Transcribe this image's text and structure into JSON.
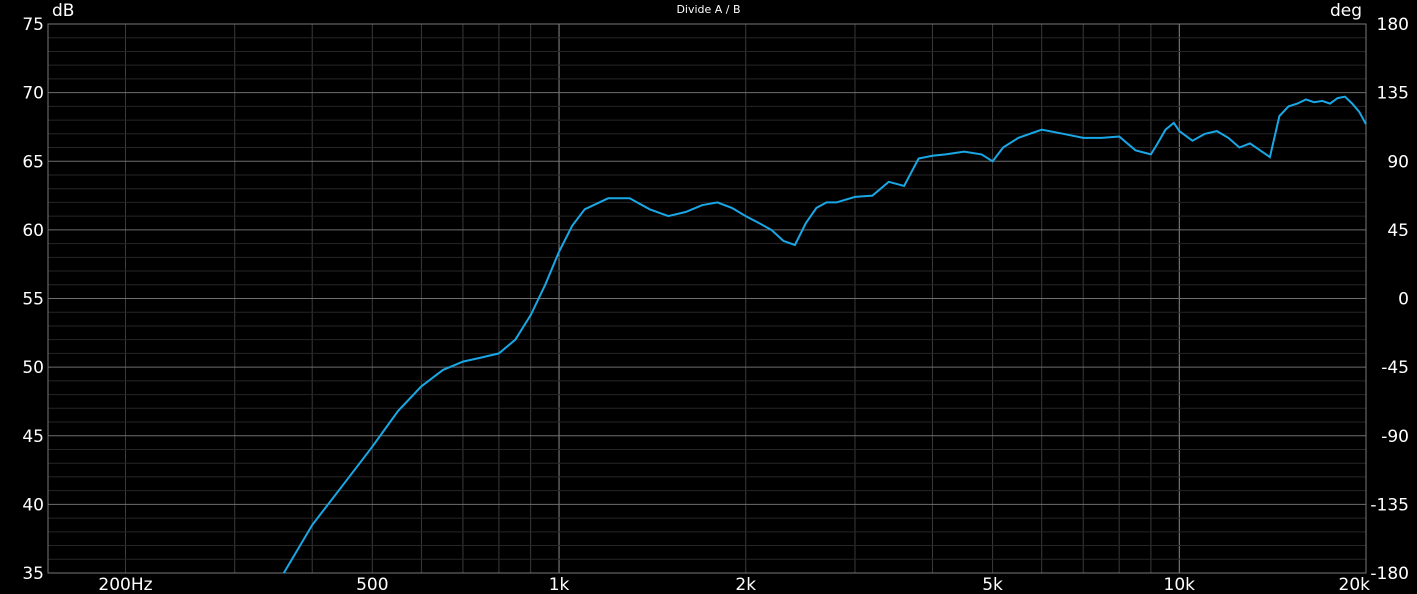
{
  "chart_data": {
    "type": "line",
    "title": "Divide A / B",
    "ylabel_left": "dB",
    "ylabel_right": "deg",
    "xscale": "log",
    "xlim": [
      150,
      20000
    ],
    "ylim": [
      35,
      75
    ],
    "ylim_right": [
      -180,
      180
    ],
    "grid": true,
    "x_ticks": [
      {
        "value": 200,
        "label": "200Hz"
      },
      {
        "value": 500,
        "label": "500"
      },
      {
        "value": 1000,
        "label": "1k"
      },
      {
        "value": 2000,
        "label": "2k"
      },
      {
        "value": 5000,
        "label": "5k"
      },
      {
        "value": 10000,
        "label": "10k"
      },
      {
        "value": 20000,
        "label": "20k"
      }
    ],
    "y_ticks_left": [
      "35",
      "40",
      "45",
      "50",
      "55",
      "60",
      "65",
      "70",
      "75"
    ],
    "y_ticks_right": [
      "-180",
      "-135",
      "-90",
      "-45",
      "0",
      "45",
      "90",
      "135",
      "180"
    ],
    "series": [
      {
        "color": "#1aa7e6",
        "x": [
          360,
          400,
          450,
          500,
          550,
          600,
          650,
          700,
          750,
          800,
          850,
          900,
          950,
          1000,
          1050,
          1100,
          1200,
          1300,
          1400,
          1500,
          1600,
          1700,
          1800,
          1900,
          2000,
          2100,
          2200,
          2300,
          2400,
          2500,
          2600,
          2700,
          2800,
          3000,
          3200,
          3400,
          3600,
          3800,
          4000,
          4200,
          4500,
          4800,
          5000,
          5200,
          5500,
          6000,
          6500,
          7000,
          7500,
          8000,
          8500,
          9000,
          9200,
          9500,
          9800,
          10000,
          10500,
          11000,
          11500,
          12000,
          12500,
          13000,
          13500,
          14000,
          14500,
          15000,
          15500,
          16000,
          16500,
          17000,
          17500,
          18000,
          18500,
          19000,
          19500,
          20000
        ],
        "y": [
          35,
          38.5,
          41.5,
          44.2,
          46.8,
          48.6,
          49.8,
          50.4,
          50.7,
          51.0,
          52.0,
          53.8,
          56.0,
          58.4,
          60.3,
          61.5,
          62.3,
          62.3,
          61.5,
          61.0,
          61.3,
          61.8,
          62.0,
          61.6,
          61.0,
          60.5,
          60.0,
          59.2,
          58.9,
          60.5,
          61.6,
          62.0,
          62.0,
          62.4,
          62.5,
          63.5,
          63.2,
          65.2,
          65.4,
          65.5,
          65.7,
          65.5,
          65.0,
          66.0,
          66.7,
          67.3,
          67.0,
          66.7,
          66.7,
          66.8,
          65.8,
          65.5,
          66.2,
          67.3,
          67.8,
          67.2,
          66.5,
          67.0,
          67.2,
          66.7,
          66.0,
          66.3,
          65.8,
          65.3,
          68.3,
          69.0,
          69.2,
          69.5,
          69.3,
          69.4,
          69.2,
          69.6,
          69.7,
          69.2,
          68.6,
          67.7
        ]
      }
    ]
  }
}
